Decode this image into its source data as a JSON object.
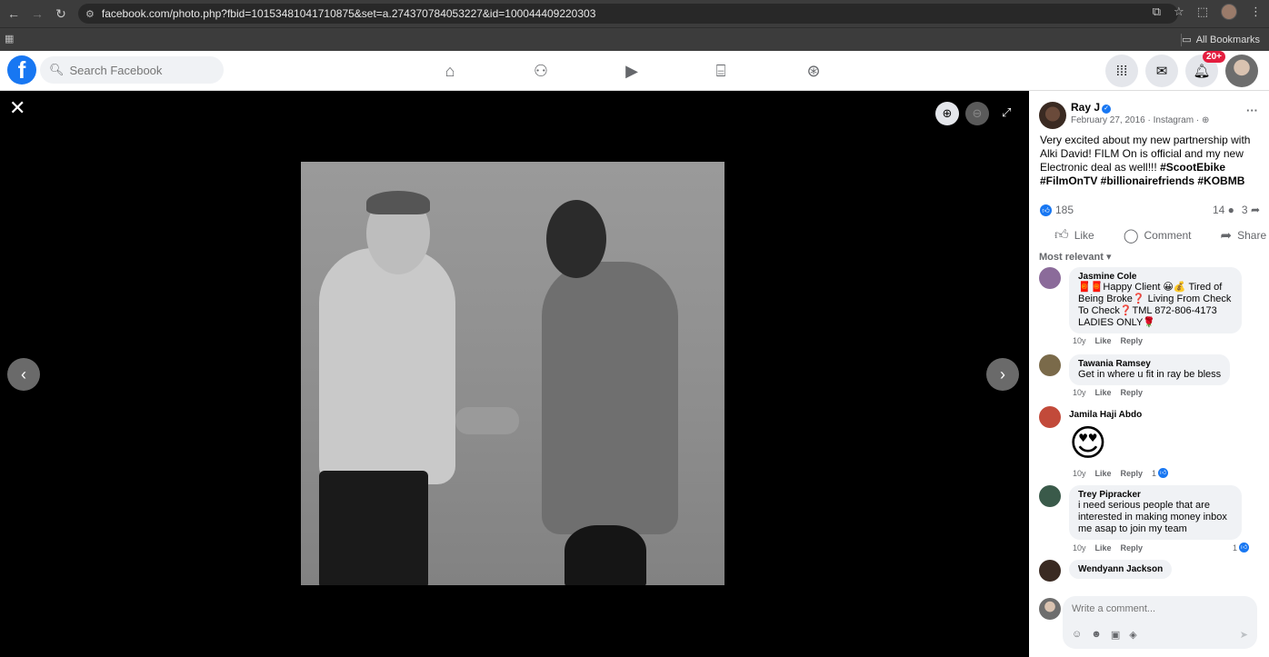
{
  "browser": {
    "url": "facebook.com/photo.php?fbid=10153481041710875&set=a.274370784053227&id=100044409220303",
    "bookmarks_label": "All Bookmarks"
  },
  "header": {
    "search_placeholder": "Search Facebook",
    "notification_count": "20+"
  },
  "post": {
    "author": "Ray J",
    "meta": "February 27, 2016 · Instagram · ",
    "text_plain": "Very excited about my new partnership with Alki David! FILM On is official and my new Electronic deal as well!!! ",
    "hashtags": "#ScootEbike #FilmOnTV #billionairefriends #KOBMB",
    "reaction_count": "185",
    "comment_count": "14",
    "share_count": "3",
    "actions": {
      "like": "Like",
      "comment": "Comment",
      "share": "Share"
    },
    "sort_label": "Most relevant"
  },
  "comments": [
    {
      "name": "Jasmine Cole",
      "text": "🧧🧧Happy Client 😀💰 Tired of Being Broke❓ Living From Check To Check❓TML 872-806-4173 LADIES ONLY🌹",
      "time": "10y",
      "like": "Like",
      "reply": "Reply",
      "likes": "",
      "avatar_color": "#8b6b9a"
    },
    {
      "name": "Tawania Ramsey",
      "text": "Get in where u fit in ray be bless",
      "time": "10y",
      "like": "Like",
      "reply": "Reply",
      "likes": "",
      "avatar_color": "#7a6a4a"
    },
    {
      "name": "Jamila Haji Abdo",
      "text": "",
      "emoji": "😍",
      "time": "10y",
      "like": "Like",
      "reply": "Reply",
      "likes": "1",
      "avatar_color": "#c24a3a"
    },
    {
      "name": "Trey Pipracker",
      "text": "i need serious people that are interested in making money inbox me asap to join my team",
      "time": "10y",
      "like": "Like",
      "reply": "Reply",
      "likes": "1",
      "avatar_color": "#3a5a4a"
    },
    {
      "name": "Wendyann Jackson",
      "text": "",
      "time": "",
      "like": "",
      "reply": "",
      "likes": "",
      "avatar_color": "#3a2a22"
    }
  ],
  "composer": {
    "placeholder": "Write a comment..."
  }
}
